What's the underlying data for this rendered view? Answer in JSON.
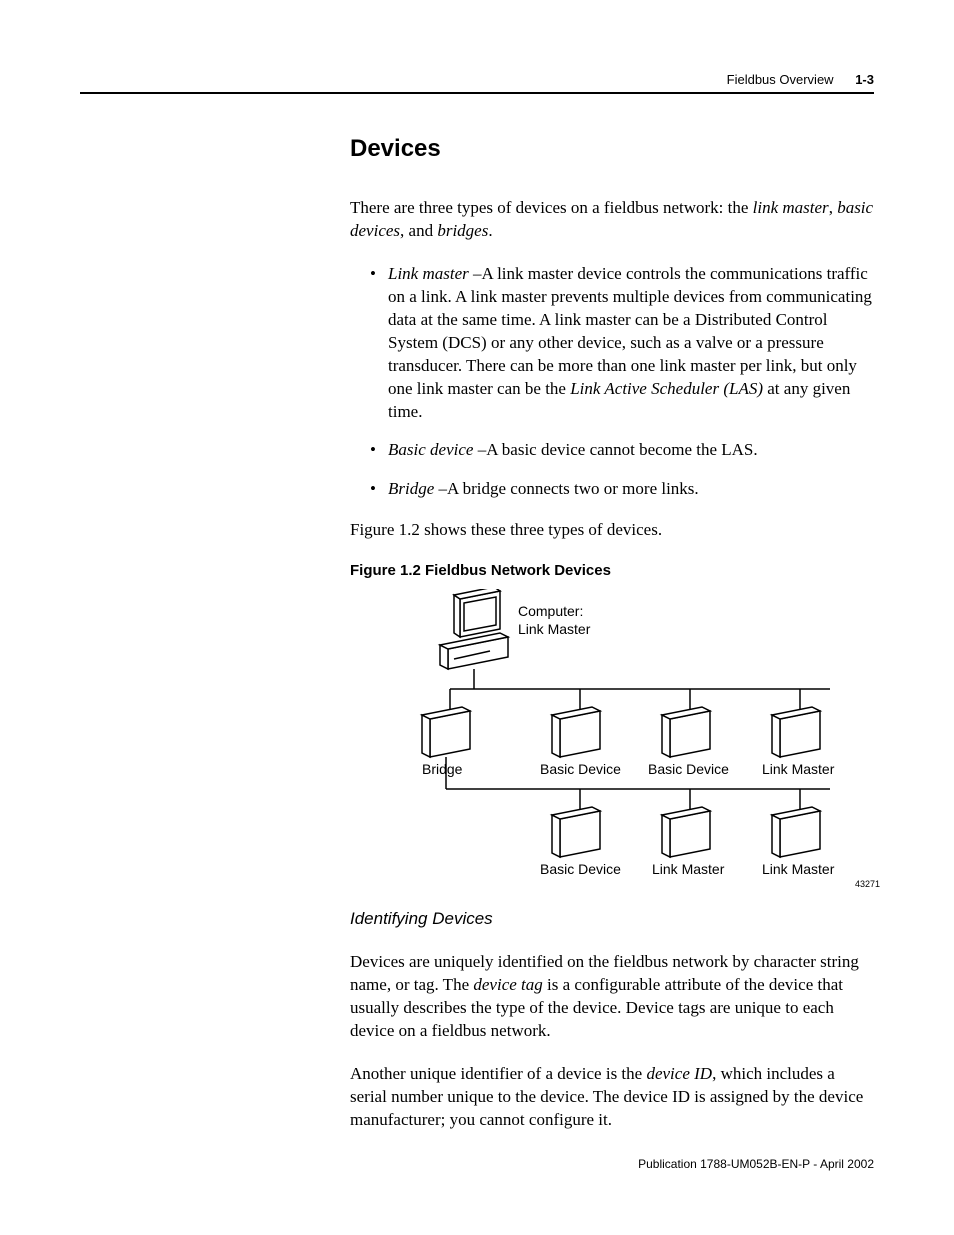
{
  "header": {
    "title": "Fieldbus Overview",
    "pagenum": "1-3"
  },
  "section_heading": "Devices",
  "intro": {
    "pre": "There are three types of devices on a fieldbus network: the ",
    "t1": "link master",
    "t2": "basic devices",
    "t3": "bridges",
    "sep1": ", ",
    "sep2": ", and ",
    "end": "."
  },
  "bullets": {
    "lm_term": "Link master",
    "lm_pre": " –A link master device controls the communications traffic on a link. A link master prevents multiple devices from communicating data at the same time. A link master can be a Distributed Control System (DCS) or any other device, such as a valve or a pressure transducer. There can be more than one link master per link, but only one link master can be the ",
    "lm_las": "Link Active Scheduler (LAS)",
    "lm_post": " at any given time.",
    "bd_term": "Basic device",
    "bd_text": " –A basic device cannot become the LAS.",
    "br_term": "Bridge",
    "br_text": " –A bridge connects two or more links."
  },
  "figref_sentence": "Figure 1.2 shows these three types of devices.",
  "figcaption": "Figure 1.2 Fieldbus Network Devices",
  "figure": {
    "computer_l1": "Computer:",
    "computer_l2": "Link Master",
    "bridge": "Bridge",
    "bd": "Basic Device",
    "lm": "Link Master",
    "ref": "43271"
  },
  "subhead": "Identifying Devices",
  "p2": {
    "pre": "Devices are uniquely identified on the fieldbus network by character string name, or tag. The ",
    "term": "device tag",
    "post": " is a configurable attribute of the device that usually describes the type of the device. Device tags are unique to each device on a fieldbus network."
  },
  "p3": {
    "pre": "Another unique identifier of a device is the ",
    "term": "device ID",
    "post": ", which includes a serial number unique to the device. The device ID is assigned by the device manufacturer; you cannot configure it."
  },
  "footer": "Publication 1788-UM052B-EN-P - April 2002"
}
